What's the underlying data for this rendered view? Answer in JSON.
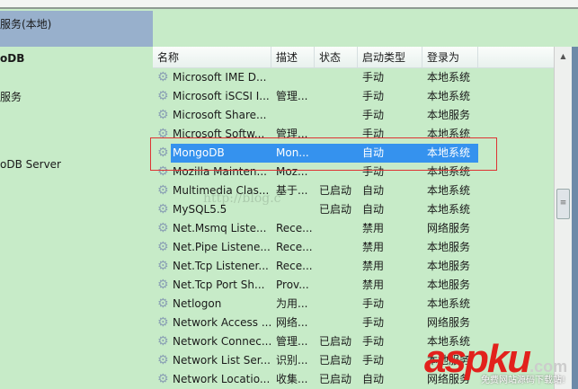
{
  "left": {
    "header": "服务(本地)",
    "items": [
      "oDB",
      "服务",
      "oDB Server"
    ]
  },
  "columns": [
    "名称",
    "描述",
    "状态",
    "启动类型",
    "登录为"
  ],
  "rows": [
    [
      "Microsoft IME D...",
      "",
      "",
      "手动",
      "本地系统"
    ],
    [
      "Microsoft iSCSI I...",
      "管理...",
      "",
      "手动",
      "本地系统"
    ],
    [
      "Microsoft Share...",
      "",
      "",
      "手动",
      "本地服务"
    ],
    [
      "Microsoft Softw...",
      "管理...",
      "",
      "手动",
      "本地系统"
    ],
    [
      "MongoDB",
      "Mon...",
      "",
      "自动",
      "本地系统"
    ],
    [
      "Mozilla Mainten...",
      "Moz...",
      "",
      "手动",
      "本地系统"
    ],
    [
      "Multimedia Clas...",
      "基于...",
      "已启动",
      "自动",
      "本地系统"
    ],
    [
      "MySQL5.5",
      "",
      "已启动",
      "自动",
      "本地系统"
    ],
    [
      "Net.Msmq Liste...",
      "Rece...",
      "",
      "禁用",
      "网络服务"
    ],
    [
      "Net.Pipe Listene...",
      "Rece...",
      "",
      "禁用",
      "本地服务"
    ],
    [
      "Net.Tcp Listener...",
      "Rece...",
      "",
      "禁用",
      "本地服务"
    ],
    [
      "Net.Tcp Port Sh...",
      "Prov...",
      "",
      "禁用",
      "本地服务"
    ],
    [
      "Netlogon",
      "为用...",
      "",
      "手动",
      "本地系统"
    ],
    [
      "Network Access ...",
      "网络...",
      "",
      "手动",
      "网络服务"
    ],
    [
      "Network Connec...",
      "管理...",
      "已启动",
      "手动",
      "本地系统"
    ],
    [
      "Network List Ser...",
      "识别...",
      "已启动",
      "手动",
      "本地服务"
    ],
    [
      "Network Locatio...",
      "收集...",
      "已启动",
      "自动",
      "网络服务"
    ]
  ],
  "selected_index": 4,
  "watermark": "http://blog.c",
  "logo": {
    "main": "aspku",
    ".com": ".com",
    "tagline": "免费网站源码下载站!"
  }
}
